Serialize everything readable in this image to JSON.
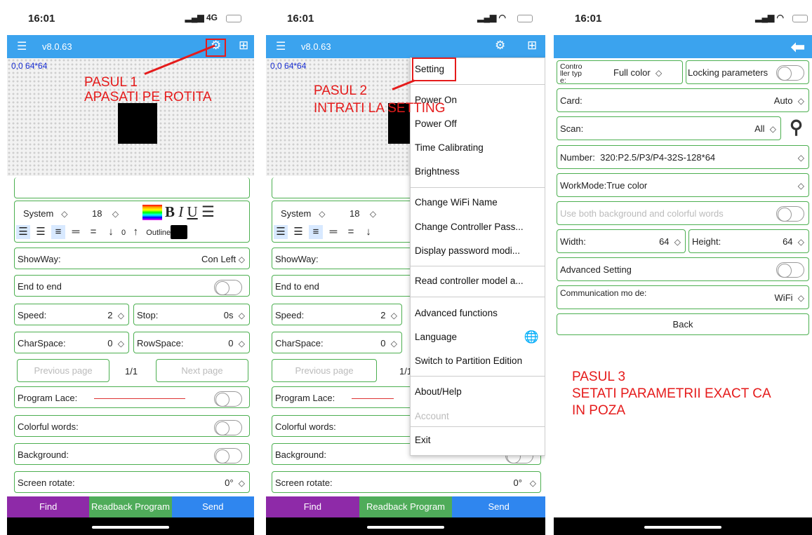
{
  "status": {
    "time": "16:01",
    "signal_p1": "4G"
  },
  "appbar": {
    "version": "v8.0.63"
  },
  "preview": {
    "coord": "0,0 64*64",
    "coord2": "0,0 64*64"
  },
  "format": {
    "font": "System",
    "size": "18",
    "biu": "B I U",
    "outline_label": "Outline",
    "outline_value": "0"
  },
  "main": {
    "showway_label": "ShowWay:",
    "showway_value": "Con Left",
    "endtoend_label": "End to end",
    "speed_label": "Speed:",
    "speed_value": "2",
    "stop_label": "Stop:",
    "stop_value": "0s",
    "charspace_label": "CharSpace:",
    "charspace_value": "0",
    "rowspace_label": "RowSpace:",
    "rowspace_value": "0",
    "prev_page": "Previous page",
    "page_num": "1/1",
    "next_page": "Next page",
    "lace_label": "Program Lace:",
    "colorful_label": "Colorful words:",
    "background_label": "Background:",
    "rotate_label": "Screen rotate:",
    "rotate_value": "0°"
  },
  "buttons": {
    "find": "Find",
    "readback": "Readback Program",
    "send": "Send"
  },
  "menu": {
    "setting": "Setting",
    "power_on": "Power On",
    "power_off": "Power Off",
    "time_cal": "Time Calibrating",
    "brightness": "Brightness",
    "wifi_name": "Change WiFi Name",
    "ctrl_pass": "Change Controller Pass...",
    "pwd_mode": "Display password modi...",
    "read_model": "Read controller model a...",
    "advanced": "Advanced functions",
    "language": "Language",
    "partition": "Switch to Partition Edition",
    "about": "About/Help",
    "account": "Account",
    "exit": "Exit"
  },
  "settings": {
    "ctrl_type_label": "Contro ller typ e:",
    "ctrl_type_value": "Full color",
    "locking_label": "Locking parameters",
    "card_label": "Card:",
    "card_value": "Auto",
    "scan_label": "Scan:",
    "scan_value": "All",
    "number_label": "Number:",
    "number_value": "320:P2.5/P3/P4-32S-128*64",
    "workmode_label": "WorkMode:True color",
    "use_both_label": "Use both background and colorful words",
    "width_label": "Width:",
    "width_value": "64",
    "height_label": "Height:",
    "height_value": "64",
    "advanced_label": "Advanced Setting",
    "comm_label": "Communication mo de:",
    "comm_value": "WiFi",
    "back": "Back"
  },
  "notes": {
    "step1_a": "PASUL 1",
    "step1_b": "APASATI PE ROTITA",
    "step2_a": "PASUL 2",
    "step2_b": "INTRATI LA SETTING",
    "step3_a": "PASUL 3",
    "step3_b": "SETATI PARAMETRII EXACT CA",
    "step3_c": "IN POZA"
  }
}
